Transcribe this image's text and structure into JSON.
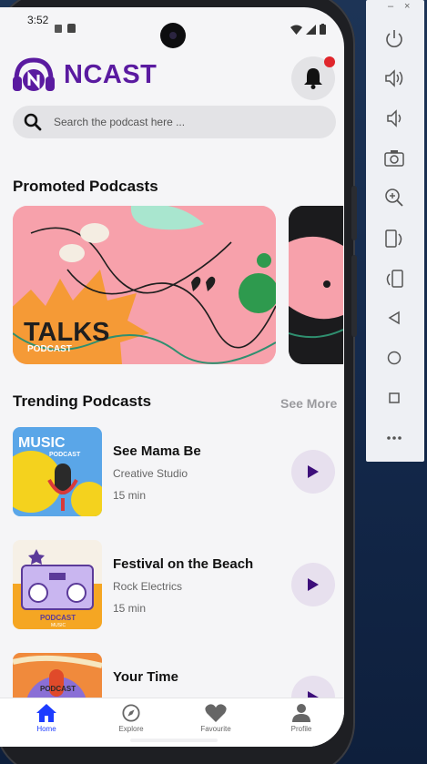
{
  "status_bar": {
    "time": "3:52"
  },
  "app": {
    "brand": "NCAST"
  },
  "search": {
    "placeholder": "Search the podcast here ..."
  },
  "promoted": {
    "title": "Promoted Podcasts",
    "cards": [
      {
        "title": "TALKS",
        "subtitle": "PODCAST"
      },
      {
        "title": "",
        "subtitle": ""
      }
    ]
  },
  "trending": {
    "title": "Trending Podcasts",
    "see_more": "See More",
    "items": [
      {
        "title": "See Mama Be",
        "artist": "Creative Studio",
        "duration": "15 min",
        "thumb_text": "MUSIC",
        "thumb_sub": "PODCAST"
      },
      {
        "title": "Festival on the Beach",
        "artist": "Rock Electrics",
        "duration": "15 min",
        "thumb_text": "PODCAST",
        "thumb_sub": "MUSIC"
      },
      {
        "title": "Your Time",
        "artist": "",
        "duration": "",
        "thumb_text": "PODCAST",
        "thumb_sub": ""
      }
    ]
  },
  "nav": {
    "items": [
      {
        "label": "Home",
        "icon": "home-icon",
        "active": true
      },
      {
        "label": "Explore",
        "icon": "compass-icon",
        "active": false
      },
      {
        "label": "Favourite",
        "icon": "heart-icon",
        "active": false
      },
      {
        "label": "Profile",
        "icon": "user-icon",
        "active": false
      }
    ]
  },
  "emulator_panel": {
    "window_controls": {
      "minimize": "–",
      "close": "×"
    },
    "buttons": [
      "power-icon",
      "volume-up-icon",
      "volume-down-icon",
      "camera-icon",
      "zoom-in-icon",
      "rotate-left-icon",
      "rotate-right-icon",
      "back-icon",
      "home-circle-icon",
      "overview-icon",
      "more-icon"
    ]
  },
  "colors": {
    "brand": "#5a1aa0",
    "accent_blue": "#1d3cff",
    "notification": "#e0262c",
    "play_bg": "#e7e0ee"
  }
}
